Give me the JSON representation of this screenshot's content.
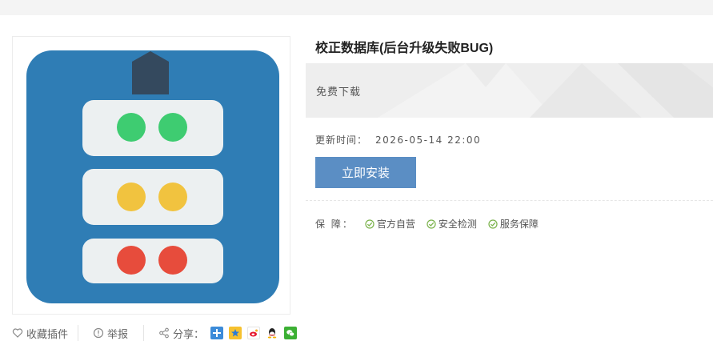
{
  "product": {
    "title": "校正数据库(后台升级失败BUG)",
    "price_label": "免费下载",
    "update_label": "更新时间：",
    "update_value": "2026-05-14 22:00",
    "install_label": "立即安装"
  },
  "guarantee": {
    "label": "保  障：",
    "items": [
      "官方自营",
      "安全检测",
      "服务保障"
    ]
  },
  "actions": {
    "favorite_label": "收藏插件",
    "report_label": "举报",
    "share_label": "分享："
  },
  "share_icons": [
    "qzone-icon",
    "qq-space-star-icon",
    "weibo-icon",
    "qq-icon",
    "wechat-icon"
  ],
  "colors": {
    "icon_bg": "#2f7db5",
    "roof": "#34495e",
    "panel": "#ecf0f1",
    "green": "#3ecc71",
    "yellow": "#f1c33f",
    "red": "#e74c3c",
    "button": "#5b8ec4"
  }
}
